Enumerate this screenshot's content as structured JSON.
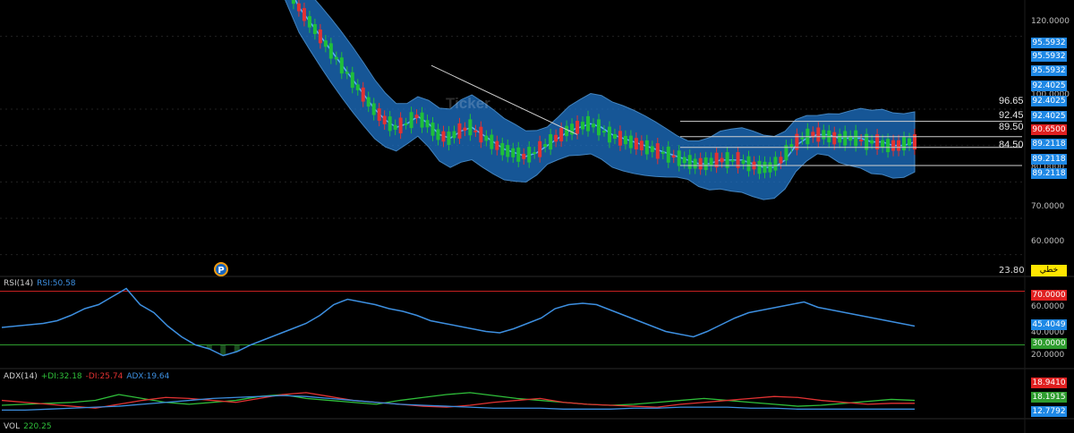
{
  "price_axis": {
    "ticks": [
      "120.0000",
      "70.0000",
      "60.0000",
      "100.0000",
      "80.0000"
    ],
    "badges": [
      {
        "label": "95.5932",
        "color": "#1e88e5"
      },
      {
        "label": "95.5932",
        "color": "#1e88e5"
      },
      {
        "label": "95.5932",
        "color": "#1e88e5"
      },
      {
        "label": "92.4025",
        "color": "#1e88e5"
      },
      {
        "label": "92.4025",
        "color": "#1e88e5"
      },
      {
        "label": "92.4025",
        "color": "#1e88e5"
      },
      {
        "label": "90.6500",
        "color": "#e02020"
      },
      {
        "label": "89.2118",
        "color": "#1e88e5"
      },
      {
        "label": "89.2118",
        "color": "#1e88e5"
      },
      {
        "label": "89.2118",
        "color": "#1e88e5"
      }
    ]
  },
  "levels": [
    {
      "label": "96.65"
    },
    {
      "label": "92.45"
    },
    {
      "label": "89.50"
    },
    {
      "label": "84.50"
    }
  ],
  "watermark": "Ticker",
  "volume_scale_label": "23.80",
  "yellow_label": "خطي",
  "rsi": {
    "title": "RSI(14)",
    "value_label": "RSI:50.58",
    "ticks": [
      "60.0000",
      "40.0000",
      "20.0000"
    ],
    "badges": [
      {
        "label": "70.0000",
        "color": "#e02020"
      },
      {
        "label": "45.4049",
        "color": "#1e88e5"
      },
      {
        "label": "30.0000",
        "color": "#2e9c2e"
      }
    ]
  },
  "adx": {
    "title": "ADX(14)",
    "plus_di": "+DI:32.18",
    "minus_di": "-DI:25.74",
    "adx": "ADX:19.64",
    "badges": [
      {
        "label": "18.9410",
        "color": "#e02020"
      },
      {
        "label": "18.1915",
        "color": "#2e9c2e"
      },
      {
        "label": "12.7792",
        "color": "#1e88e5"
      }
    ]
  },
  "vol": {
    "title": "VOL",
    "value": "220.25"
  },
  "colors": {
    "up": "#1fbf3a",
    "down": "#e23232",
    "band": "#1e73c8",
    "mid": "#5cb0ff",
    "rsi": "#3d8fe0"
  },
  "chart_data": {
    "type": "line",
    "title": "",
    "price_ylim": [
      55,
      130
    ],
    "closes": [
      140,
      134,
      128,
      124,
      120,
      116,
      112,
      108,
      104,
      100,
      97,
      95,
      96,
      98,
      96,
      93,
      92,
      94,
      95,
      93,
      91,
      89,
      88,
      87,
      88,
      90,
      92,
      94,
      95,
      96,
      95,
      93,
      92,
      91,
      90,
      89,
      88,
      87,
      86,
      85,
      85,
      86,
      86,
      86,
      85,
      84,
      84,
      86,
      90,
      92,
      93,
      93,
      92,
      92,
      92,
      91,
      91,
      90,
      90,
      91
    ],
    "horizontal_levels": [
      96.65,
      92.45,
      89.5,
      84.5
    ],
    "rsi_ylim": [
      15,
      75
    ],
    "rsi": [
      43,
      44,
      45,
      46,
      48,
      52,
      57,
      60,
      66,
      72,
      60,
      54,
      44,
      36,
      30,
      27,
      22,
      25,
      30,
      34,
      38,
      42,
      46,
      52,
      60,
      64,
      62,
      60,
      57,
      55,
      52,
      48,
      46,
      44,
      42,
      40,
      39,
      42,
      46,
      50,
      57,
      60,
      61,
      60,
      56,
      52,
      48,
      44,
      40,
      38,
      36,
      40,
      45,
      50,
      54,
      56,
      58,
      60,
      62,
      58,
      56,
      54,
      52,
      50,
      48,
      46,
      44
    ],
    "rsi_levels": [
      70,
      30
    ],
    "adx_ylim": [
      5,
      40
    ],
    "plus_di": [
      17,
      18,
      19,
      20,
      22,
      28,
      24,
      20,
      18,
      20,
      22,
      26,
      28,
      24,
      22,
      20,
      18,
      22,
      25,
      28,
      30,
      27,
      24,
      22,
      20,
      18,
      17,
      18,
      20,
      22,
      24,
      22,
      20,
      18,
      16,
      17,
      19,
      21,
      23,
      22
    ],
    "minus_di": [
      22,
      20,
      18,
      16,
      14,
      18,
      22,
      25,
      24,
      22,
      20,
      24,
      28,
      30,
      26,
      22,
      20,
      18,
      16,
      15,
      17,
      20,
      22,
      24,
      20,
      18,
      17,
      16,
      15,
      18,
      20,
      22,
      24,
      26,
      25,
      22,
      20,
      18,
      19,
      19
    ],
    "adx_line": [
      12,
      12,
      13,
      14,
      15,
      16,
      18,
      20,
      22,
      24,
      25,
      26,
      27,
      26,
      24,
      22,
      20,
      18,
      17,
      16,
      15,
      14,
      14,
      14,
      13,
      13,
      13,
      14,
      14,
      15,
      15,
      15,
      14,
      14,
      13,
      13,
      13,
      13,
      13,
      13
    ]
  }
}
